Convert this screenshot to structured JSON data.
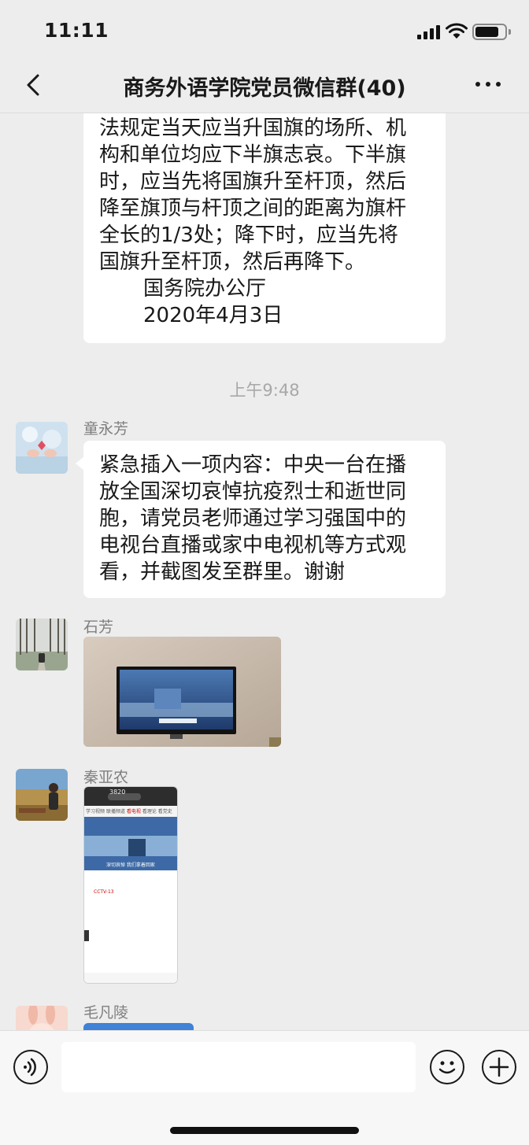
{
  "status_bar": {
    "time": "11:11",
    "battery_level": 0.8
  },
  "nav": {
    "title": "商务外语学院党员微信群(40)",
    "back_icon": "chevron-left-icon",
    "more_icon": "ellipsis-icon"
  },
  "messages": {
    "first": {
      "lines": [
        "法规定当天应当升国旗的场所、机",
        "构和单位均应下半旗志哀。下半旗",
        "时，应当先将国旗升至杆顶，然后",
        "降至旗顶与杆顶之间的距离为旗杆",
        "全长的1/3处；降下时，应当先将",
        "国旗升至杆顶，然后再降下。"
      ],
      "signature": "国务院办公厅",
      "date": "2020年4月3日"
    },
    "timestamp": "上午9:48",
    "tong": {
      "sender": "童永芳",
      "lines": [
        "紧急插入一项内容：中央一台在播",
        "放全国深切哀悼抗疫烈士和逝世同",
        "胞，请党员老师通过学习强国中的",
        "电视台直播或家中电视机等方式观",
        "看，并截图发至群里。谢谢"
      ]
    },
    "shi": {
      "sender": "石芳"
    },
    "qin": {
      "sender": "秦亚农",
      "screenshot": {
        "points": "3820",
        "tabs": [
          "学习视频",
          "联播频道",
          "看电视",
          "看理论",
          "看党史"
        ],
        "caption": "深切哀悼 我们拿着回家",
        "channel": "CCTV-13"
      }
    },
    "mao": {
      "sender": "毛凡陵"
    }
  },
  "input_bar": {
    "voice_icon": "voice-icon",
    "emoji_icon": "emoji-icon",
    "plus_icon": "plus-icon",
    "input_value": ""
  }
}
